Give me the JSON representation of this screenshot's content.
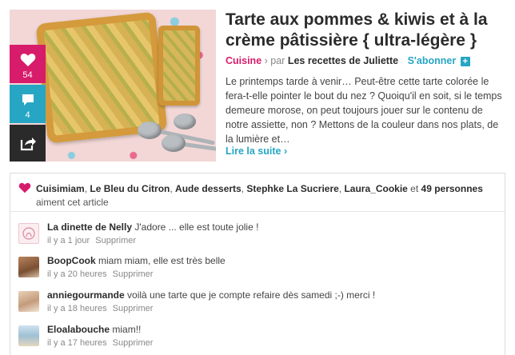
{
  "colors": {
    "accent_pink": "#d71c6b",
    "accent_blue": "#27a6c4",
    "dark": "#2a2a2a"
  },
  "post": {
    "title": "Tarte aux pommes & kiwis et à la crème pâtissière { ultra-légère }",
    "category": "Cuisine",
    "by": "› par",
    "author": "Les recettes de Juliette",
    "subscribe_label": "S'abonner",
    "subscribe_plus": "+",
    "excerpt": "Le printemps tarde à venir… Peut-être cette tarte colorée le fera-t-elle pointer le bout du nez ? Quoiqu'il en soit, si le temps demeure morose, on peut toujours jouer sur le contenu de notre assiette, non ? Mettons de la couleur dans nos plats, de la lumière et…",
    "read_more": "Lire la suite ›",
    "like_count": "54",
    "comment_count": "4",
    "icons": {
      "like": "heart-icon",
      "comment": "speech-bubble-icon",
      "share": "share-icon"
    }
  },
  "likes": {
    "users": [
      "Cuisimiam",
      "Le Bleu du Citron",
      "Aude desserts",
      "Stephke La Sucriere",
      "Laura_Cookie"
    ],
    "sep": ", ",
    "and": " et ",
    "others": "49 personnes",
    "suffix": " aiment cet article"
  },
  "comments": [
    {
      "author": "La dinette de Nelly",
      "text": "J'adore ... elle est toute jolie !",
      "time": "il y a 1 jour",
      "delete_label": "Supprimer"
    },
    {
      "author": "BoopCook",
      "text": "miam miam, elle est très belle",
      "time": "il y a 20 heures",
      "delete_label": "Supprimer"
    },
    {
      "author": "anniegourmande",
      "text": "voilà une tarte que je compte refaire dès samedi ;-) merci !",
      "time": "il y a 18 heures",
      "delete_label": "Supprimer"
    },
    {
      "author": "Eloalabouche",
      "text": "miam!!",
      "time": "il y a 17 heures",
      "delete_label": "Supprimer"
    }
  ]
}
